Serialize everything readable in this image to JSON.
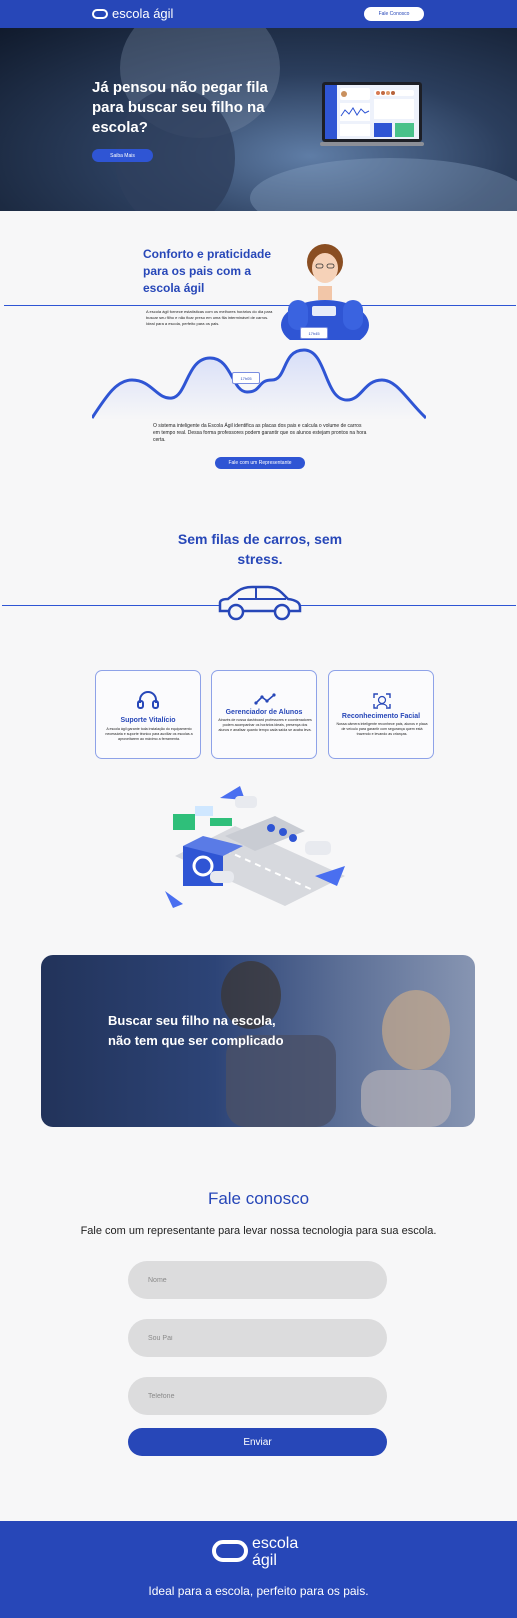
{
  "header": {
    "logo_text": "escola ágil",
    "contact_button": "Fale Conosco"
  },
  "hero": {
    "title": "Já pensou não pegar fila para buscar seu filho na escola?",
    "button": "Saiba Mais"
  },
  "comfort": {
    "title": "Conforto e praticidade para os pais com a escola ágil",
    "text": "A escola ágil fornece estatísticas com os melhores horários do dia para buscar seu filho e não ficar preso em uma fila interminável de carros. Ideal para a escola, perfeito para os pais.",
    "tag_1": "17h45",
    "tag_2": "17h05",
    "body": "O sistema inteligente da Escola Ágil identifica as placas dos pais e calcula o volume de carros em tempo real. Dessa forma professores podem garantir que os alunos estejam prontos na hora certa.",
    "rep_button": "Fale com um Representante"
  },
  "no_queues": {
    "title": "Sem filas de carros, sem stress."
  },
  "features": [
    {
      "title": "Suporte Vitalício",
      "text": "A escola ágil garante toda instalação do equipamento necessária e suporte técnico para auxiliar os escolas a aproveitarem ao máximo a ferramenta.",
      "icon": "headset-icon"
    },
    {
      "title": "Gerenciador de Alunos",
      "text": "Através de nossa dashboard professores e coordenadores podem acompanhar os horários ideais, presença dos alunos e analisar quanto tempo cada saída se acaba leva.",
      "icon": "chart-line-icon"
    },
    {
      "title": "Reconhecimento Facial",
      "text": "Nossa câmera inteligente reconhece pais, alunos e placa de veículo para garantir com segurança quem está trazendo e levando as crianças.",
      "icon": "face-scan-icon"
    }
  ],
  "banner": {
    "title": "Buscar seu filho na escola, não tem que ser complicado"
  },
  "contact": {
    "title": "Fale conosco",
    "subtitle": "Fale com um representante para levar nossa tecnologia para sua escola.",
    "name_placeholder": "Nome",
    "role_placeholder": "Sou Pai",
    "phone_placeholder": "Telefone",
    "submit": "Enviar"
  },
  "footer": {
    "logo_line_1": "escola",
    "logo_line_2": "ágil",
    "tagline": "Ideal para a escola, perfeito para os pais."
  },
  "colors": {
    "brand": "#2747b8",
    "accent": "#2f55d4",
    "background": "#f7f7f8"
  }
}
